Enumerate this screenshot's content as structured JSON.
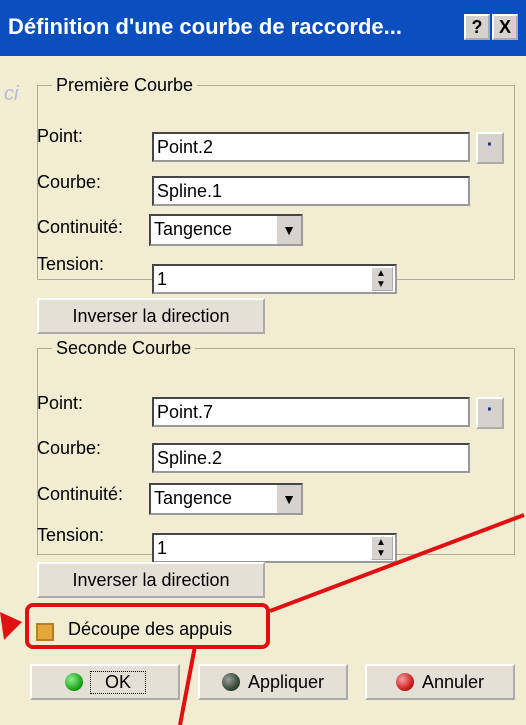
{
  "window": {
    "title": "Définition d'une courbe de raccorde...",
    "help": "?",
    "close": "X",
    "faint_text": "ci"
  },
  "first_curve": {
    "legend": "Première Courbe",
    "point_label": "Point:",
    "point_value": "Point.2",
    "curve_label": "Courbe:",
    "curve_value": "Spline.1",
    "continuity_label": "Continuité:",
    "continuity_value": "Tangence",
    "tension_label": "Tension:",
    "tension_value": "1"
  },
  "invert1": "Inverser la direction",
  "second_curve": {
    "legend": "Seconde Courbe",
    "point_label": "Point:",
    "point_value": "Point.7",
    "curve_label": "Courbe:",
    "curve_value": "Spline.2",
    "continuity_label": "Continuité:",
    "continuity_value": "Tangence",
    "tension_label": "Tension:",
    "tension_value": "1"
  },
  "invert2": "Inverser la direction",
  "trim_label": "Découpe des appuis",
  "buttons": {
    "ok": "OK",
    "apply": "Appliquer",
    "cancel": "Annuler"
  },
  "colors": {
    "title_bg": "#0a4fbd",
    "dialog_bg": "#f2ecd3",
    "highlight": "#e01010",
    "ok_ball": "#1faa1f",
    "apply_ball": "#3a4a3a",
    "cancel_ball": "#d02020"
  }
}
